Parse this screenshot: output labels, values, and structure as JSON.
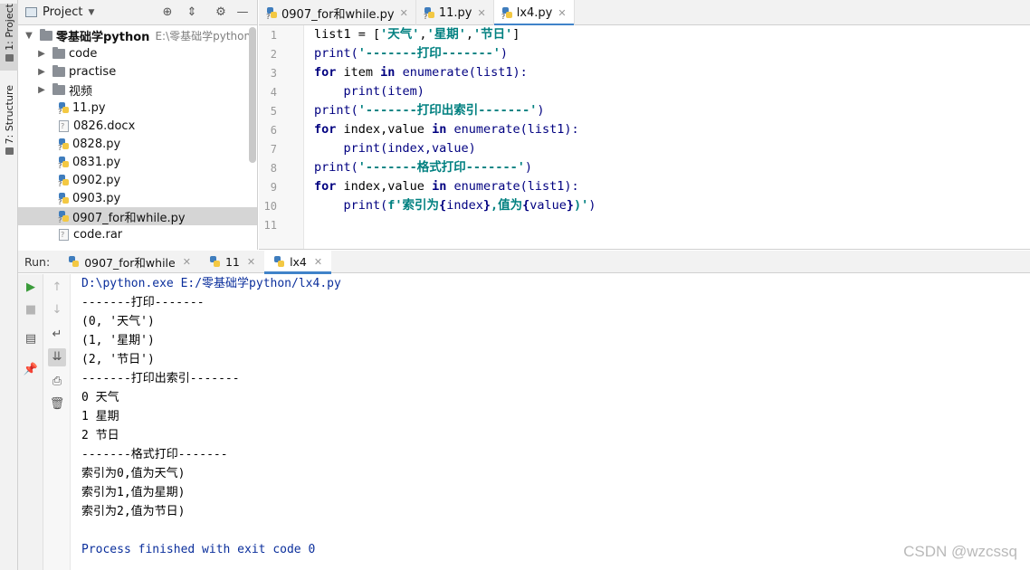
{
  "sidebar": {
    "tabs": [
      {
        "label": "1: Project",
        "active": true
      },
      {
        "label": "7: Structure",
        "active": false
      }
    ]
  },
  "project": {
    "title": "Project",
    "root": {
      "name": "零基础学python",
      "path": "E:\\零基础学python"
    },
    "items": [
      {
        "label": "code",
        "type": "folder"
      },
      {
        "label": "practise",
        "type": "folder"
      },
      {
        "label": "视频",
        "type": "folder"
      },
      {
        "label": "11.py",
        "type": "py"
      },
      {
        "label": "0826.docx",
        "type": "doc"
      },
      {
        "label": "0828.py",
        "type": "py"
      },
      {
        "label": "0831.py",
        "type": "py"
      },
      {
        "label": "0902.py",
        "type": "py"
      },
      {
        "label": "0903.py",
        "type": "py"
      },
      {
        "label": "0907_for和while.py",
        "type": "py",
        "selected": true
      },
      {
        "label": "code.rar",
        "type": "doc"
      }
    ]
  },
  "editor": {
    "tabs": [
      {
        "label": "0907_for和while.py",
        "active": false
      },
      {
        "label": "11.py",
        "active": false
      },
      {
        "label": "lx4.py",
        "active": true
      }
    ],
    "line_numbers": [
      "1",
      "2",
      "3",
      "4",
      "5",
      "6",
      "7",
      "8",
      "9",
      "10",
      "11"
    ],
    "code": [
      [
        "list1 = [",
        "'天气'",
        ",",
        "'星期'",
        ",",
        "'节日'",
        "]"
      ],
      [
        "print(",
        "'-------打印-------'",
        ")"
      ],
      [
        "for",
        " item ",
        "in",
        " enumerate(list1):"
      ],
      [
        "    print(item)"
      ],
      [
        "print(",
        "'-------打印出索引-------'",
        ")"
      ],
      [
        "for",
        " index,value ",
        "in",
        " enumerate(list1):"
      ],
      [
        "    print(index,value)"
      ],
      [
        "print(",
        "'-------格式打印-------'",
        ")"
      ],
      [
        "for",
        " index,value ",
        "in",
        " enumerate(list1):"
      ],
      [
        "    print(",
        "f'索引为",
        "{",
        "index",
        "}",
        ",值为",
        "{",
        "value",
        "}",
        ")'",
        ")"
      ]
    ]
  },
  "run": {
    "label": "Run:",
    "tabs": [
      {
        "label": "0907_for和while",
        "active": false
      },
      {
        "label": "11",
        "active": false
      },
      {
        "label": "lx4",
        "active": true
      }
    ],
    "output": [
      "D:\\python.exe E:/零基础学python/lx4.py",
      "-------打印-------",
      "(0, '天气')",
      "(1, '星期')",
      "(2, '节日')",
      "-------打印出索引-------",
      "0 天气",
      "1 星期",
      "2 节日",
      "-------格式打印-------",
      "索引为0,值为天气)",
      "索引为1,值为星期)",
      "索引为2,值为节日)",
      "",
      "Process finished with exit code 0"
    ]
  },
  "watermark": "CSDN @wzcssq",
  "colors": {
    "accent": "#4083c9",
    "keyword": "#000080",
    "string": "#008080",
    "console_cmd": "#0b2f9c"
  }
}
